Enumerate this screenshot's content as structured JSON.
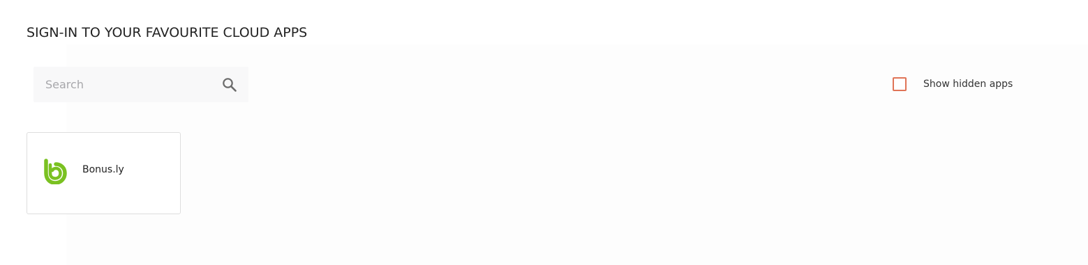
{
  "page": {
    "title": "SIGN-IN TO YOUR FAVOURITE CLOUD APPS"
  },
  "search": {
    "placeholder": "Search",
    "value": "",
    "icon": "search-icon"
  },
  "filters": {
    "show_hidden_label": "Show hidden apps",
    "show_hidden_checked": false,
    "checkbox_color": "#e07457"
  },
  "apps": [
    {
      "name": "Bonus.ly",
      "icon": "bonusly-logo-icon",
      "brand_color": "#7ac121"
    }
  ]
}
